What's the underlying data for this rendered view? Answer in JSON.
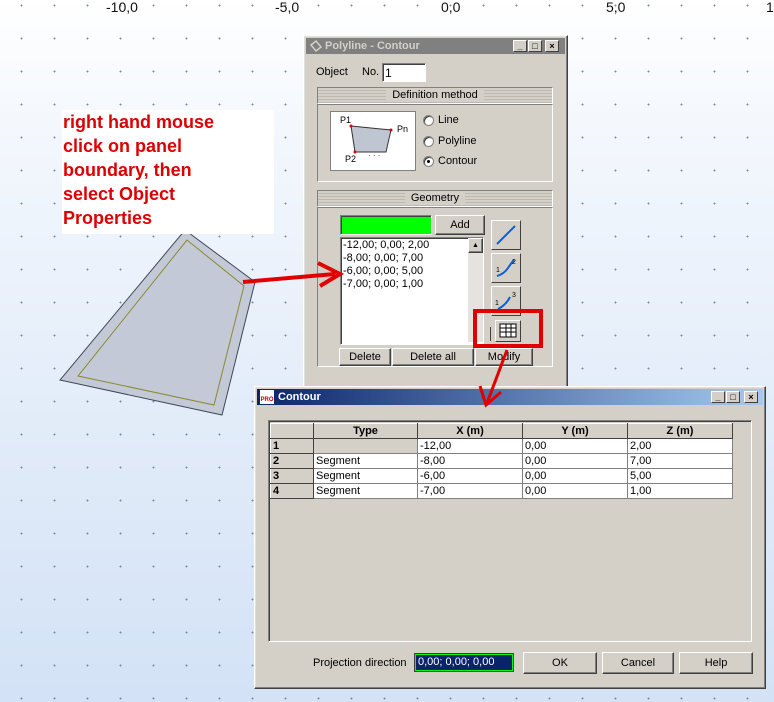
{
  "ruler": {
    "labels": [
      "-10,0",
      "-5,0",
      "0,0",
      "5,0",
      "1"
    ]
  },
  "annotation": {
    "lines": [
      "right hand mouse",
      "click on panel",
      "boundary, then",
      "select Object",
      "Properties"
    ]
  },
  "polyline_window": {
    "title": "Polyline - Contour",
    "object_label": "Object",
    "no_label": "No.",
    "object_no": "1",
    "definition_method": {
      "title": "Definition method",
      "preview_labels": {
        "p1": "P1",
        "pn": "Pn",
        "p2": "P2"
      },
      "options": [
        "Line",
        "Polyline",
        "Contour"
      ],
      "selected": "Contour"
    },
    "geometry": {
      "title": "Geometry",
      "add_label": "Add",
      "points": [
        "-12,00; 0,00; 2,00",
        "-8,00; 0,00; 7,00",
        "-6,00; 0,00; 5,00",
        "-7,00; 0,00; 1,00"
      ],
      "delete_label": "Delete",
      "delete_all_label": "Delete all",
      "modify_label": "Modify"
    }
  },
  "contour_window": {
    "title": "Contour",
    "app_badge": "PRO",
    "columns": [
      "Type",
      "X (m)",
      "Y (m)",
      "Z (m)"
    ],
    "rows": [
      {
        "n": "1",
        "type": "",
        "x": "-12,00",
        "y": "0,00",
        "z": "2,00"
      },
      {
        "n": "2",
        "type": "Segment",
        "x": "-8,00",
        "y": "0,00",
        "z": "7,00"
      },
      {
        "n": "3",
        "type": "Segment",
        "x": "-6,00",
        "y": "0,00",
        "z": "5,00"
      },
      {
        "n": "4",
        "type": "Segment",
        "x": "-7,00",
        "y": "0,00",
        "z": "1,00"
      }
    ],
    "projection_label": "Projection direction",
    "projection_value": "0,00; 0,00; 0,00",
    "ok_label": "OK",
    "cancel_label": "Cancel",
    "help_label": "Help"
  },
  "colors": {
    "highlight": "#e00000",
    "green_field": "#00ff00",
    "panel_fill": "#c3c9d6"
  }
}
